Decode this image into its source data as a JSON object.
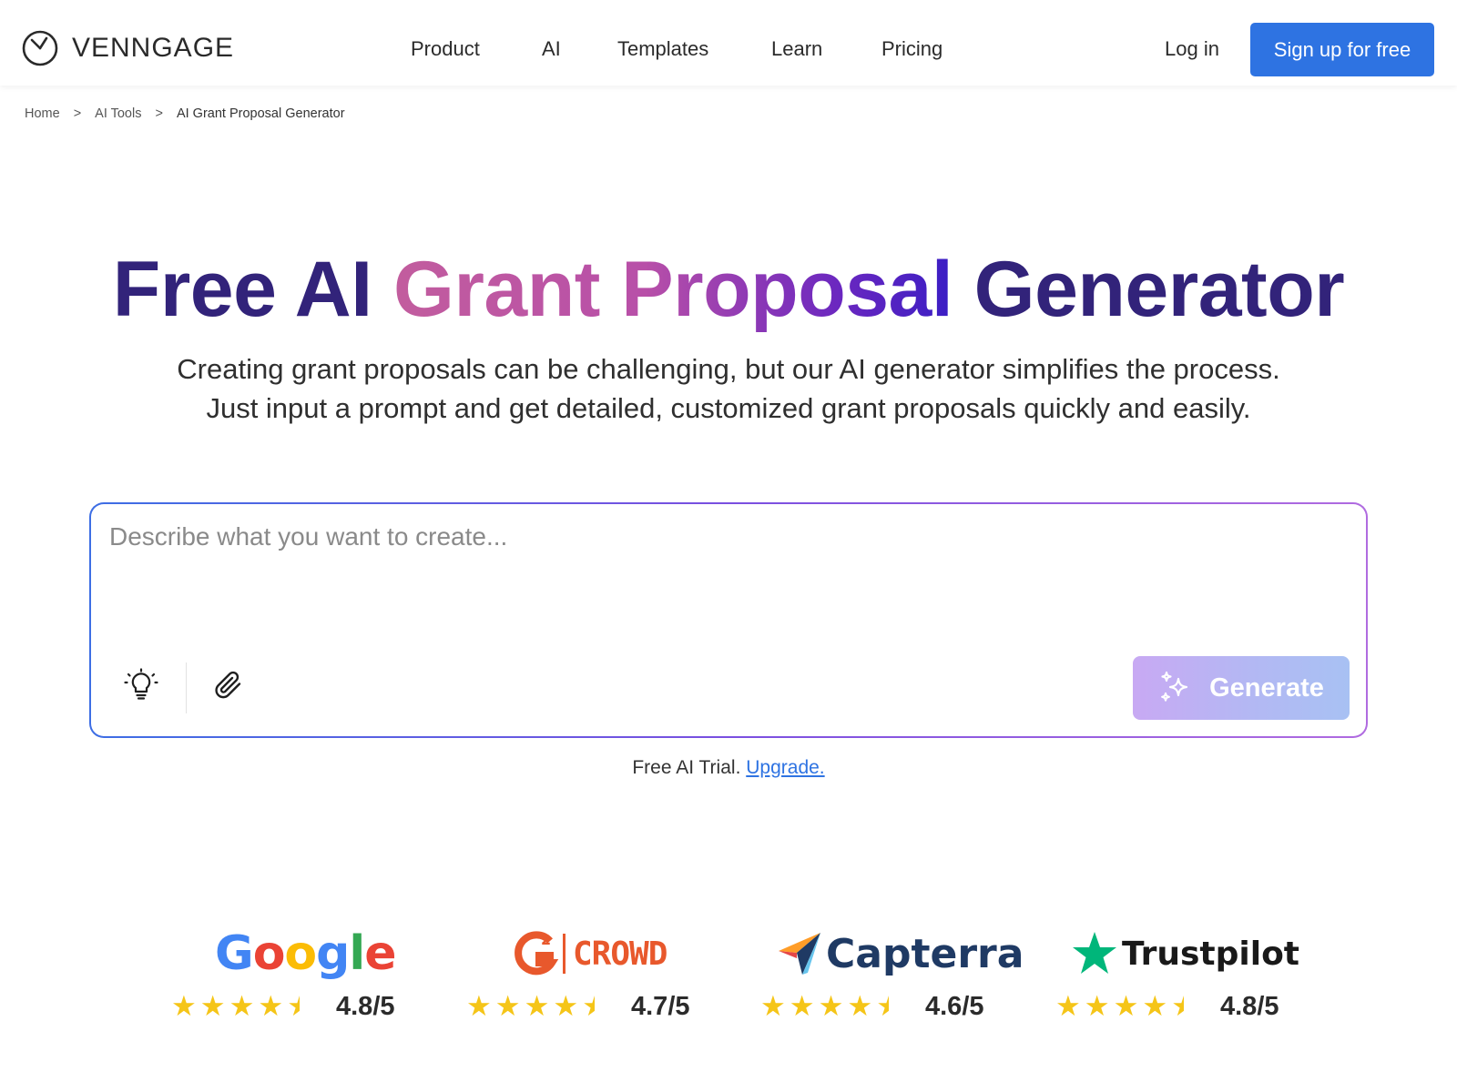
{
  "header": {
    "logo_text": "VENNGAGE",
    "nav": [
      "Product",
      "AI",
      "Templates",
      "Learn",
      "Pricing"
    ],
    "login_label": "Log in",
    "signup_label": "Sign up for free",
    "accent_color": "#2e73e2"
  },
  "breadcrumb": {
    "items": [
      "Home",
      "AI Tools",
      "AI Grant Proposal Generator"
    ],
    "separator": ">"
  },
  "hero": {
    "title_part1": "Free AI ",
    "title_gradient": "Grant Proposal",
    "title_part2": " Generator",
    "subtitle_line1": "Creating grant proposals can be challenging, but our AI generator simplifies the process.",
    "subtitle_line2": "Just input a prompt and get detailed, customized grant proposals quickly and easily."
  },
  "prompt": {
    "placeholder": "Describe what you want to create...",
    "value": "",
    "idea_icon": "lightbulb-icon",
    "attach_icon": "paperclip-icon",
    "generate_label": "Generate",
    "generate_icon": "sparkles-icon"
  },
  "trial": {
    "text": "Free AI Trial.",
    "upgrade_label": "Upgrade."
  },
  "ratings": [
    {
      "brand": "Google",
      "score": "4.8/5",
      "stars": 4.5
    },
    {
      "brand": "G2 CROWD",
      "score": "4.7/5",
      "stars": 4.5
    },
    {
      "brand": "Capterra",
      "score": "4.6/5",
      "stars": 4.5
    },
    {
      "brand": "Trustpilot",
      "score": "4.8/5",
      "stars": 4.5
    }
  ],
  "colors": {
    "title_dark": "#32237a",
    "star": "#f5c518",
    "google_blue": "#4285f4",
    "google_red": "#ea4335",
    "google_yellow": "#fbbc05",
    "google_green": "#34a853",
    "g2_orange": "#e8582c",
    "capterra_navy": "#1f3a64",
    "trustpilot_green": "#00b67a"
  }
}
